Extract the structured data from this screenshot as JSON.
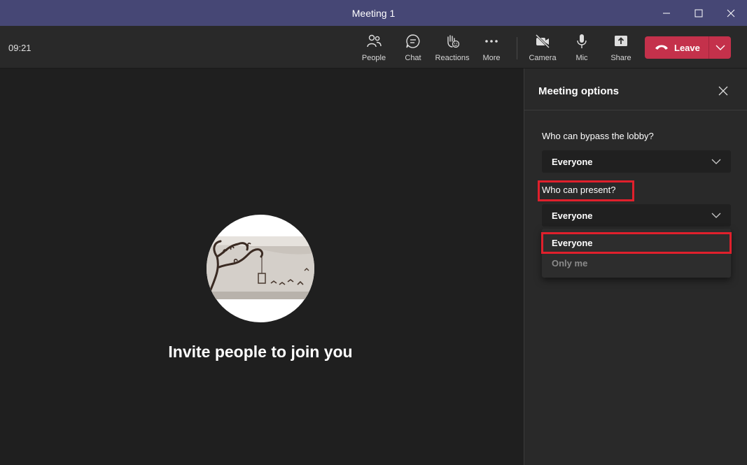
{
  "window": {
    "title": "Meeting 1"
  },
  "toolbar": {
    "clock": "09:21",
    "items": [
      {
        "label": "People",
        "icon": "people-icon"
      },
      {
        "label": "Chat",
        "icon": "chat-icon"
      },
      {
        "label": "Reactions",
        "icon": "reactions-icon"
      },
      {
        "label": "More",
        "icon": "more-icon"
      },
      {
        "label": "Camera",
        "icon": "camera-off-icon"
      },
      {
        "label": "Mic",
        "icon": "mic-icon"
      },
      {
        "label": "Share",
        "icon": "share-icon"
      }
    ],
    "leave_label": "Leave"
  },
  "stage": {
    "invite_text": "Invite people to join you"
  },
  "panel": {
    "title": "Meeting options",
    "lobby": {
      "label": "Who can bypass the lobby?",
      "value": "Everyone"
    },
    "present": {
      "label": "Who can present?",
      "value": "Everyone",
      "options": [
        "Everyone",
        "Only me"
      ]
    }
  },
  "colors": {
    "titlebar": "#464775",
    "leave_button": "#c4314b",
    "highlight": "#e0202c"
  }
}
